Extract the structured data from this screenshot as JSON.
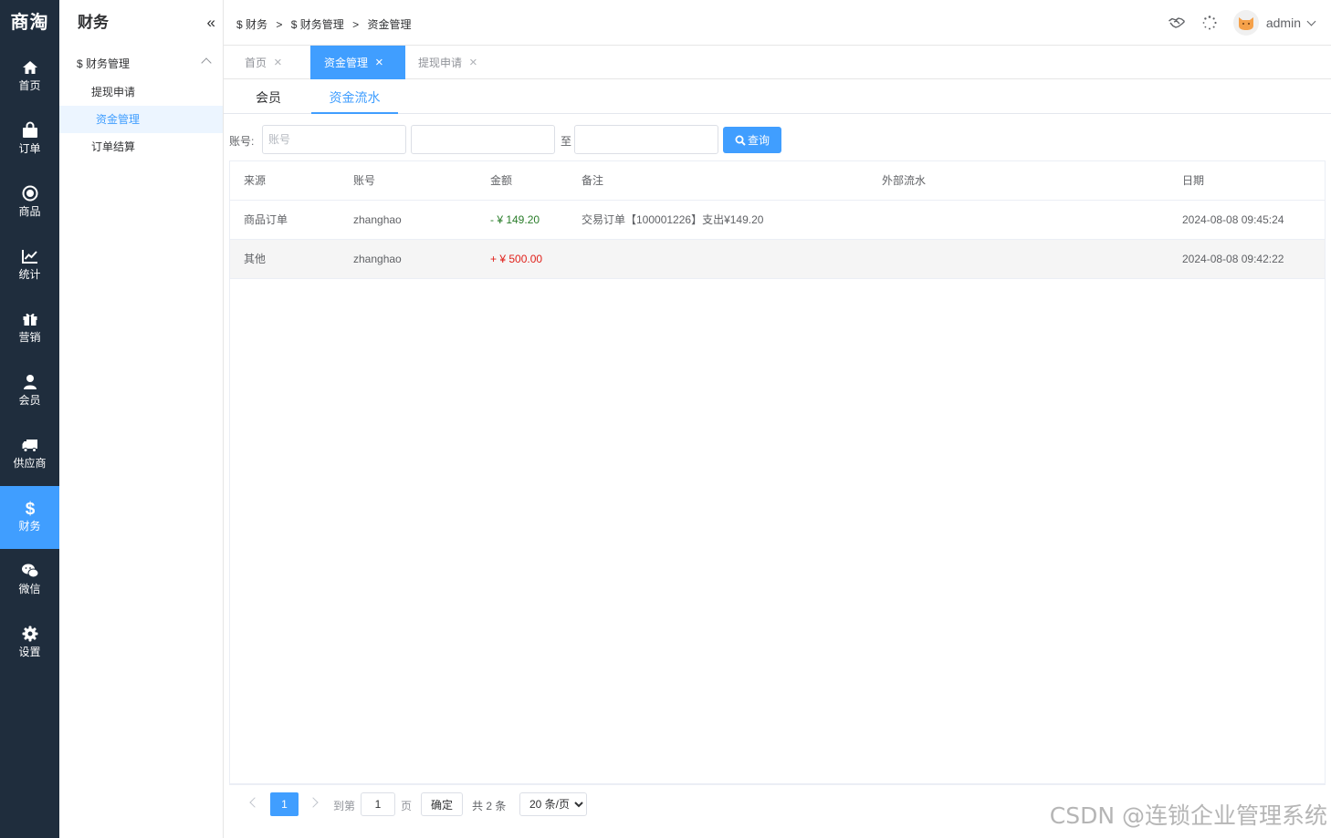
{
  "brand": "商淘",
  "rail": [
    {
      "label": "首页",
      "icon": "home-icon"
    },
    {
      "label": "订单",
      "icon": "shopping-bag-icon"
    },
    {
      "label": "商品",
      "icon": "target-icon"
    },
    {
      "label": "统计",
      "icon": "line-chart-icon"
    },
    {
      "label": "营销",
      "icon": "gift-icon"
    },
    {
      "label": "会员",
      "icon": "user-icon"
    },
    {
      "label": "供应商",
      "icon": "truck-icon"
    },
    {
      "label": "财务",
      "icon": "dollar-icon"
    },
    {
      "label": "微信",
      "icon": "wechat-icon"
    },
    {
      "label": "设置",
      "icon": "gear-icon"
    }
  ],
  "rail_active": "财务",
  "sidebar": {
    "title": "财务",
    "collapse": "«",
    "group": "$ 财务管理",
    "items": [
      "提现申请",
      "资金管理",
      "订单结算"
    ],
    "active": "资金管理"
  },
  "breadcrumb": {
    "items": [
      "$ 财务",
      "$ 财务管理",
      "资金管理"
    ],
    "separator": ">"
  },
  "user": {
    "name": "admin"
  },
  "tabs": [
    {
      "label": "首页",
      "active": false
    },
    {
      "label": "资金管理",
      "active": true
    },
    {
      "label": "提现申请",
      "active": false
    }
  ],
  "close_glyph": "×",
  "subtabs": [
    {
      "label": "会员",
      "active": false
    },
    {
      "label": "资金流水",
      "active": true
    }
  ],
  "filter": {
    "account_label": "账号:",
    "account_placeholder": "账号",
    "to_label": "至",
    "query_label": "查询"
  },
  "table": {
    "columns": [
      "来源",
      "账号",
      "金额",
      "备注",
      "外部流水",
      "日期"
    ],
    "rows": [
      {
        "source": "商品订单",
        "account": "zhanghao",
        "amount": "- ¥ 149.20",
        "amount_type": "out",
        "note": "交易订单【100001226】支出¥149.20",
        "external": "",
        "date": "2024-08-08 09:45:24"
      },
      {
        "source": "其他",
        "account": "zhanghao",
        "amount": "+ ¥ 500.00",
        "amount_type": "in",
        "note": "",
        "external": "",
        "date": "2024-08-08 09:42:22"
      }
    ]
  },
  "pager": {
    "current": "1",
    "goto_label": "到第",
    "goto_value": "1",
    "page_unit": "页",
    "confirm": "确定",
    "total": "共 2 条",
    "page_size": "20 条/页"
  },
  "colors": {
    "primary": "#409eff",
    "rail_bg": "#1f2d3d",
    "amount_out": "#2a7d2a",
    "amount_in": "#e0211b"
  },
  "watermark": "CSDN @连锁企业管理系统"
}
